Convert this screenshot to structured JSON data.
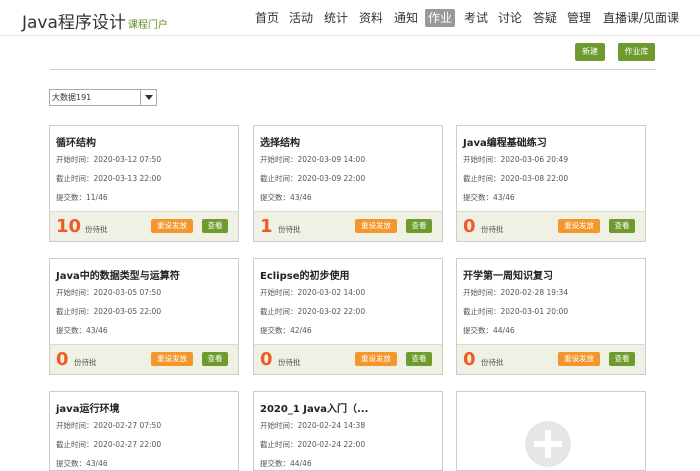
{
  "header": {
    "title": "Java程序设计",
    "subtitle": "课程门户",
    "nav": [
      "首页",
      "活动",
      "统计",
      "资料",
      "通知",
      "作业",
      "考试",
      "讨论",
      "答疑",
      "管理",
      "直播课/见面课"
    ],
    "active_nav": "作业"
  },
  "toolbar": {
    "new_label": "新建",
    "library_label": "作业库"
  },
  "filter": {
    "selected": "大数据191"
  },
  "labels": {
    "start": "开始时间：",
    "end": "截止时间：",
    "submit": "提交数：",
    "pending": "份待批",
    "reset": "重设发放",
    "view": "查看"
  },
  "assignments": [
    {
      "title": "循环结构",
      "start": "2020-03-12 07:50",
      "end": "2020-03-13 22:00",
      "submitted": "11/46",
      "pending": "10"
    },
    {
      "title": "选择结构",
      "start": "2020-03-09 14:00",
      "end": "2020-03-09 22:00",
      "submitted": "43/46",
      "pending": "1"
    },
    {
      "title": "Java编程基础练习",
      "start": "2020-03-06 20:49",
      "end": "2020-03-08 22:00",
      "submitted": "43/46",
      "pending": "0"
    },
    {
      "title": "Java中的数据类型与运算符",
      "start": "2020-03-05 07:50",
      "end": "2020-03-05 22:00",
      "submitted": "43/46",
      "pending": "0"
    },
    {
      "title": "Eclipse的初步使用",
      "start": "2020-03-02 14:00",
      "end": "2020-03-02 22:00",
      "submitted": "42/46",
      "pending": "0"
    },
    {
      "title": "开学第一周知识复习",
      "start": "2020-02-28 19:34",
      "end": "2020-03-01 20:00",
      "submitted": "44/46",
      "pending": "0"
    },
    {
      "title": "java运行环境",
      "start": "2020-02-27 07:50",
      "end": "2020-02-27 22:00",
      "submitted": "43/46",
      "pending": ""
    },
    {
      "title": "2020_1 Java入门（...",
      "start": "2020-02-24 14:38",
      "end": "2020-02-24 22:00",
      "submitted": "44/46",
      "pending": ""
    }
  ],
  "colors": {
    "accent_green": "#6f9a2e",
    "accent_orange": "#f4962b",
    "count_red": "#f05a24"
  }
}
